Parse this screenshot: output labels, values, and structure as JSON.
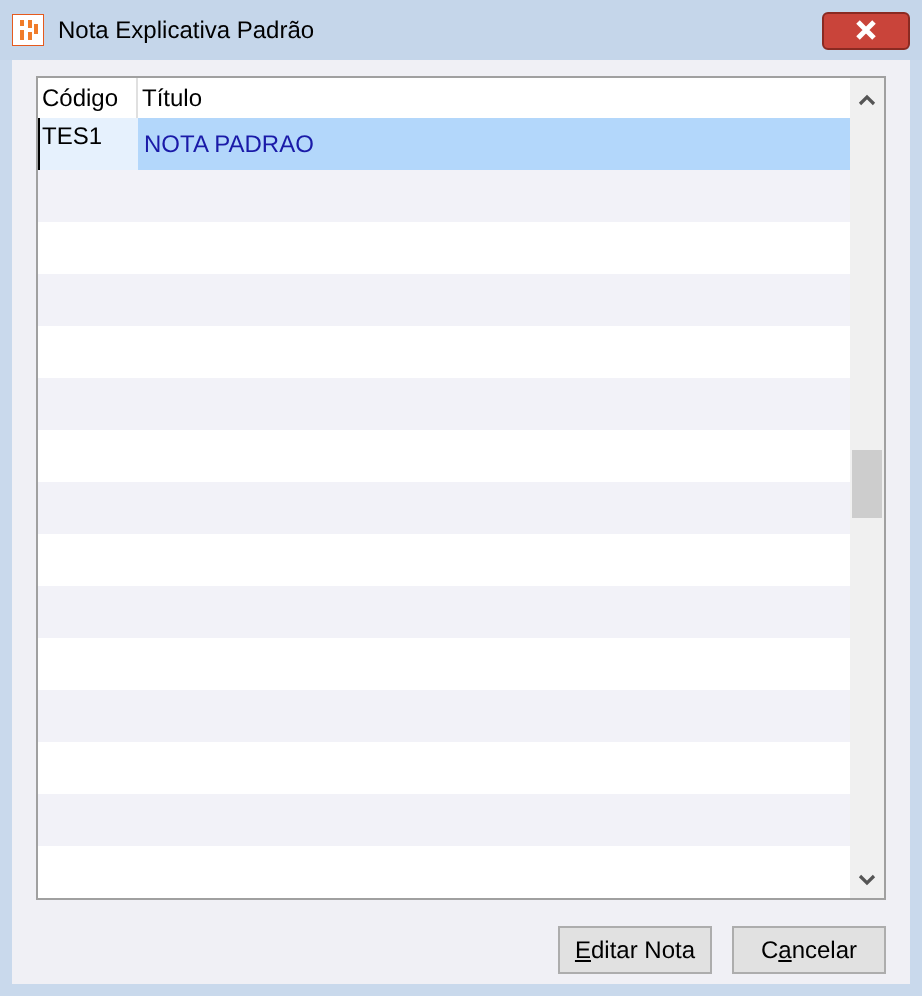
{
  "window": {
    "title": "Nota Explicativa Padrão"
  },
  "table": {
    "columns": [
      "Código",
      "Título"
    ],
    "rows": [
      {
        "selected": true,
        "cells": [
          {
            "text": "TES1",
            "focused": true
          },
          {
            "text": "NOTA PADRAO",
            "focused": false
          }
        ]
      }
    ]
  },
  "buttons": [
    {
      "hotkey": "E",
      "rest": "ditar Nota"
    },
    {
      "before": "C",
      "hotkey": "a",
      "rest": "ncelar"
    }
  ]
}
